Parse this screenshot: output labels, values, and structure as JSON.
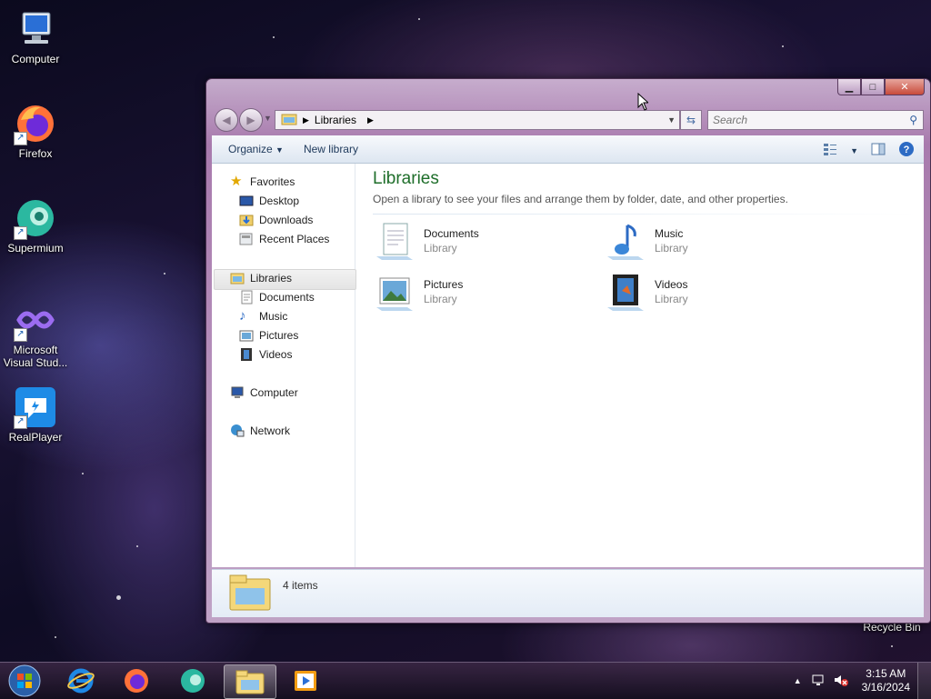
{
  "desktop": {
    "icons": [
      {
        "label": "Computer"
      },
      {
        "label": "Firefox"
      },
      {
        "label": "Supermium"
      },
      {
        "label": "Microsoft Visual Stud..."
      },
      {
        "label": "RealPlayer"
      },
      {
        "label": "Recycle Bin"
      }
    ]
  },
  "explorer": {
    "address": {
      "crumb": "Libraries"
    },
    "search": {
      "placeholder": "Search"
    },
    "toolbar": {
      "organize": "Organize",
      "new_library": "New library"
    },
    "nav": {
      "favorites": "Favorites",
      "favorites_items": [
        "Desktop",
        "Downloads",
        "Recent Places"
      ],
      "libraries": "Libraries",
      "libraries_items": [
        "Documents",
        "Music",
        "Pictures",
        "Videos"
      ],
      "computer": "Computer",
      "network": "Network"
    },
    "main": {
      "title": "Libraries",
      "subtitle": "Open a library to see your files and arrange them by folder, date, and other properties.",
      "libraries": [
        {
          "name": "Documents",
          "type": "Library"
        },
        {
          "name": "Music",
          "type": "Library"
        },
        {
          "name": "Pictures",
          "type": "Library"
        },
        {
          "name": "Videos",
          "type": "Library"
        }
      ]
    },
    "details": {
      "count": "4 items"
    }
  },
  "taskbar": {
    "clock": {
      "time": "3:15 AM",
      "date": "3/16/2024"
    }
  },
  "colors": {
    "title_green": "#1e6e2a",
    "link_blue": "#1e395b"
  }
}
